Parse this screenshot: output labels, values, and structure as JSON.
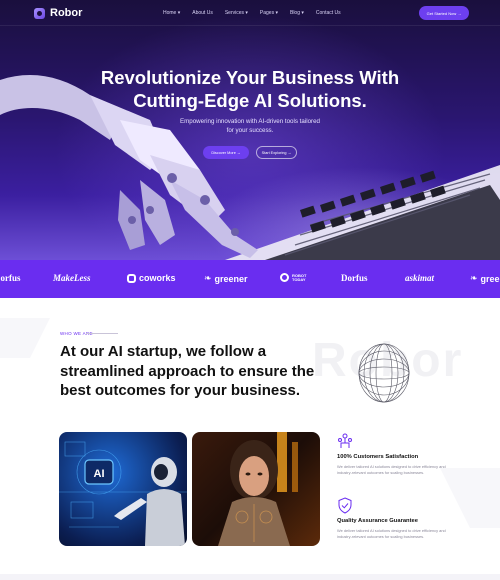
{
  "nav": {
    "logo": "Robor",
    "menu": [
      "Home ▾",
      "About Us",
      "Services ▾",
      "Pages ▾",
      "Blog ▾",
      "Contact Us"
    ],
    "cta": "Get Started Now →"
  },
  "hero": {
    "title_line1": "Revolutionize Your Business With",
    "title_line2": "Cutting-Edge AI Solutions.",
    "subtitle_line1": "Empowering innovation with AI-driven tools tailored",
    "subtitle_line2": "for your success.",
    "primary_button": "Discover More →",
    "secondary_button": "Start Exploring →"
  },
  "brands": [
    "Dorfus",
    "MakeLess",
    "coworks",
    "greener",
    "ROBOT TODAY",
    "Dorfus",
    "askimat",
    "greener"
  ],
  "about": {
    "tag": "WHO WE ARE",
    "title": "At our AI startup, we follow a streamlined approach to ensure the best outcomes for your business.",
    "ghost_text": "Robor",
    "features": [
      {
        "title": "100% Customers Satisfaction",
        "text": "We deliver tailored AI solutions designed to drive efficiency and industry-relevant outcomes for scaling businesses."
      },
      {
        "title": "Quality Assurance Guarantee",
        "text": "We deliver tailored AI solutions designed to drive efficiency and industry-relevant outcomes for scaling businesses."
      }
    ]
  },
  "colors": {
    "accent": "#6a2df0",
    "hero_dark": "#1a0f3d",
    "text_dark": "#111111"
  }
}
